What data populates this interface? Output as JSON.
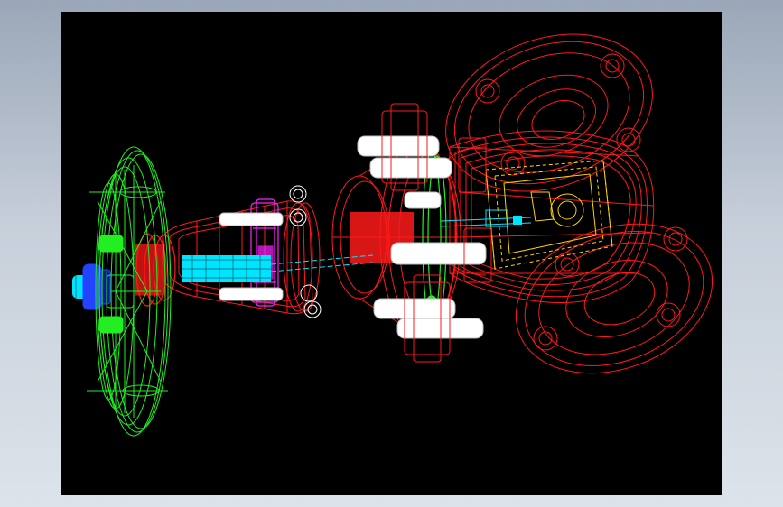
{
  "window": {
    "background_top": "#9aa7b8",
    "background_bottom": "#dde3ea"
  },
  "viewport": {
    "background": "#000000",
    "render_style": "3D wireframe",
    "subject": "gate-valve-assembly"
  },
  "colors": {
    "body": "#ff1a1a",
    "handwheel": "#22ee22",
    "bolts": "#ffffff",
    "stem": "#00e5ff",
    "yoke_nut": "#ff22ff",
    "gate_disc": "#ffd400",
    "gland": "#2244ff"
  },
  "parts": [
    {
      "name": "handwheel",
      "color": "#22ee22"
    },
    {
      "name": "stem",
      "color": "#00e5ff"
    },
    {
      "name": "bonnet",
      "color": "#ff1a1a"
    },
    {
      "name": "body-flange-bolts",
      "color": "#ffffff"
    },
    {
      "name": "gate-disc",
      "color": "#ffd400"
    },
    {
      "name": "pipe-flanges",
      "color": "#ff1a1a"
    }
  ]
}
